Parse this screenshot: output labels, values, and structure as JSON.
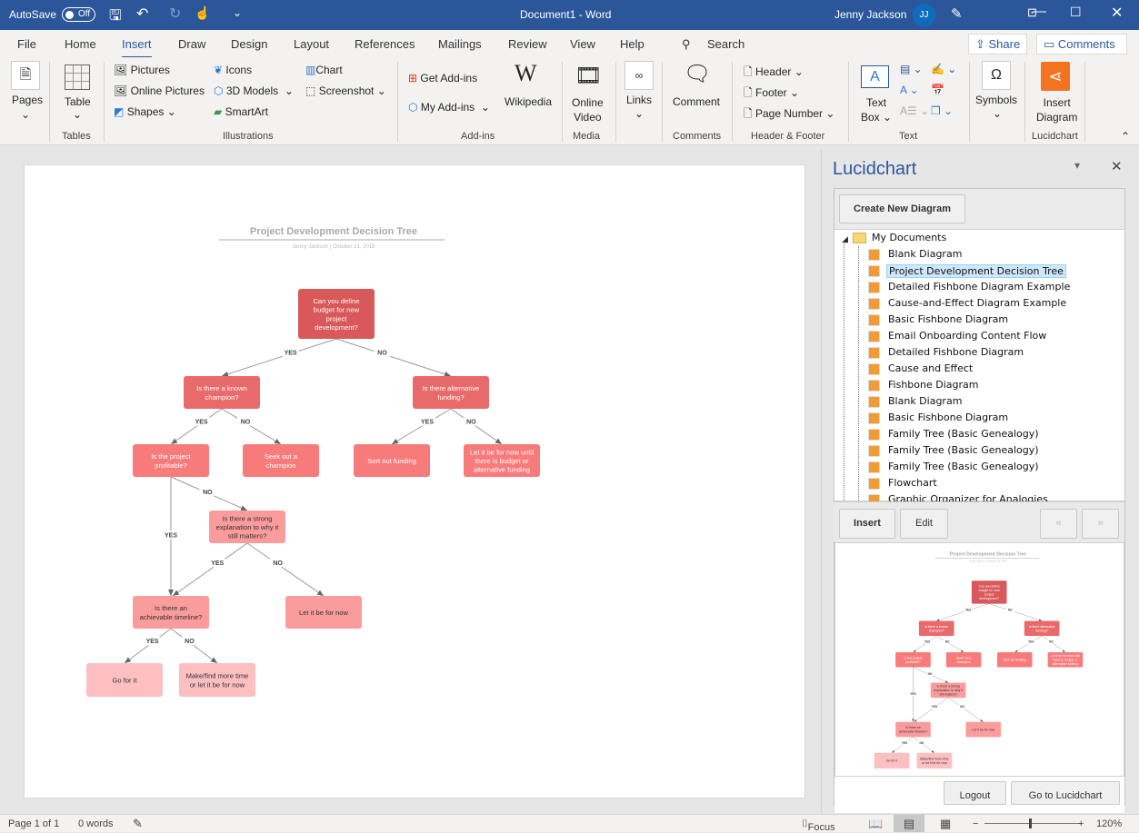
{
  "titlebar": {
    "autosave": "AutoSave",
    "autosave_state": "Off",
    "doc_title": "Document1  -  Word",
    "user": "Jenny Jackson",
    "initials": "JJ"
  },
  "menu": {
    "tabs": [
      "File",
      "Home",
      "Insert",
      "Draw",
      "Design",
      "Layout",
      "References",
      "Mailings",
      "Review",
      "View",
      "Help"
    ],
    "active": "Insert",
    "search": "Search",
    "share": "Share",
    "comments": "Comments"
  },
  "ribbon": {
    "pages": "Pages",
    "table": "Table",
    "tables_group": "Tables",
    "pictures": "Pictures",
    "online_pictures": "Online Pictures",
    "shapes": "Shapes",
    "icons": "Icons",
    "models3d": "3D Models",
    "smartart": "SmartArt",
    "chart": "Chart",
    "screenshot": "Screenshot",
    "illustrations_group": "Illustrations",
    "get_addins": "Get Add-ins",
    "my_addins": "My Add-ins",
    "wikipedia": "Wikipedia",
    "addins_group": "Add-ins",
    "online_video": [
      "Online",
      "Video"
    ],
    "media_group": "Media",
    "links": "Links",
    "comment": "Comment",
    "comments_group": "Comments",
    "header": "Header",
    "footer": "Footer",
    "page_number": "Page Number",
    "hf_group": "Header & Footer",
    "text_box": [
      "Text",
      "Box"
    ],
    "text_group": "Text",
    "symbols": "Symbols",
    "insert_diagram": [
      "Insert",
      "Diagram"
    ],
    "lucid_group": "Lucidchart",
    "lucid_color": "#f37321"
  },
  "diagram": {
    "title": "Project Development Decision Tree",
    "subtitle": "Jenny Jackson  |  October 21, 2019",
    "nodes": [
      {
        "id": "root",
        "lines": [
          "Can you define",
          "budget for new",
          "project",
          "development?"
        ],
        "color": "#d9585a"
      },
      {
        "id": "champ",
        "lines": [
          "Is there a known",
          "champion?"
        ],
        "color": "#e96a6a"
      },
      {
        "id": "altfund",
        "lines": [
          "Is there alternative",
          "funding?"
        ],
        "color": "#e96a6a"
      },
      {
        "id": "profit",
        "lines": [
          "Is the project",
          "profitable?"
        ],
        "color": "#f77b7b"
      },
      {
        "id": "seek",
        "lines": [
          "Seek out a",
          "champion"
        ],
        "color": "#f77b7b"
      },
      {
        "id": "sort",
        "lines": [
          "Sort out funding"
        ],
        "color": "#f77b7b"
      },
      {
        "id": "letuntil",
        "lines": [
          "Let it be for now until",
          "there is budget or",
          "alternative funding"
        ],
        "color": "#f77b7b"
      },
      {
        "id": "strong",
        "lines": [
          "Is there a strong",
          "explanation to why it",
          "still matters?"
        ],
        "color": "#fb9c9c"
      },
      {
        "id": "timeline",
        "lines": [
          "Is there an",
          "achievable timeline?"
        ],
        "color": "#fb9c9c"
      },
      {
        "id": "letnow",
        "lines": [
          "Let it be for now"
        ],
        "color": "#fb9c9c"
      },
      {
        "id": "go",
        "lines": [
          "Go for it"
        ],
        "color": "#fdbfbf"
      },
      {
        "id": "make",
        "lines": [
          "Make/find more time",
          "or let it be for now"
        ],
        "color": "#fdbfbf"
      }
    ],
    "edges": [
      {
        "from": "root",
        "to": "champ",
        "label": "YES"
      },
      {
        "from": "root",
        "to": "altfund",
        "label": "NO"
      },
      {
        "from": "champ",
        "to": "profit",
        "label": "YES"
      },
      {
        "from": "champ",
        "to": "seek",
        "label": "NO"
      },
      {
        "from": "altfund",
        "to": "sort",
        "label": "YES"
      },
      {
        "from": "altfund",
        "to": "letuntil",
        "label": "NO"
      },
      {
        "from": "profit",
        "to": "timeline",
        "label": "YES"
      },
      {
        "from": "profit",
        "to": "strong",
        "label": "NO"
      },
      {
        "from": "strong",
        "to": "timeline",
        "label": "YES"
      },
      {
        "from": "strong",
        "to": "letnow",
        "label": "NO"
      },
      {
        "from": "timeline",
        "to": "go",
        "label": "YES"
      },
      {
        "from": "timeline",
        "to": "make",
        "label": "NO"
      }
    ]
  },
  "pane": {
    "title": "Lucidchart",
    "create": "Create New Diagram",
    "folder": "My Documents",
    "documents": [
      "Blank Diagram",
      "Project Development Decision Tree",
      "Detailed Fishbone Diagram Example",
      "Cause-and-Effect Diagram Example",
      "Basic Fishbone Diagram",
      "Email Onboarding Content Flow",
      "Detailed Fishbone Diagram",
      "Cause and Effect",
      "Fishbone Diagram",
      "Blank Diagram",
      "Basic Fishbone Diagram",
      "Family Tree (Basic Genealogy)",
      "Family Tree (Basic Genealogy)",
      "Family Tree (Basic Genealogy)",
      "Flowchart",
      "Graphic Organizer for Analogies"
    ],
    "selected": "Project Development Decision Tree",
    "insert": "Insert",
    "edit": "Edit",
    "prev": "«",
    "next": "»",
    "logout": "Logout",
    "goto": "Go to Lucidchart"
  },
  "status": {
    "page": "Page 1 of 1",
    "words": "0 words",
    "focus": "Focus",
    "zoom": "120%",
    "zoom_level": 120
  }
}
